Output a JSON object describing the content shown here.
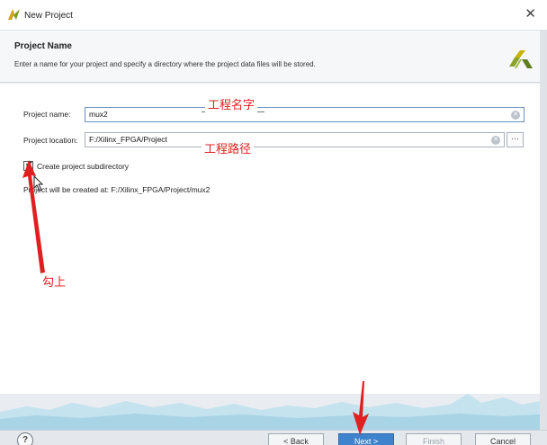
{
  "window": {
    "title": "New Project",
    "close_glyph": "✕"
  },
  "header": {
    "title": "Project Name",
    "description": "Enter a name for your project and specify a directory where the project data files will be stored."
  },
  "form": {
    "name_label": "Project name:",
    "name_value": "mux2",
    "location_label": "Project location:",
    "location_value": "F:/Xilinx_FPGA/Project",
    "browse_label": "···",
    "checkbox_label": "Create project subdirectory",
    "checkbox_checked": true,
    "checkbox_glyph": "✔",
    "created_at_text": "Project will be created at: F:/Xilinx_FPGA/Project/mux2"
  },
  "annotations": {
    "project_name": "工程名字",
    "project_path": "工程路径",
    "check_it": "勾上"
  },
  "footer": {
    "help": "?",
    "back": "< Back",
    "next": "Next >",
    "finish": "Finish",
    "cancel": "Cancel"
  },
  "colors": {
    "annotation": "#e02020",
    "primary_button": "#3f83cc"
  },
  "icons": {
    "app": "vivado-logo-icon",
    "logo": "xilinx-logo-icon",
    "clear": "clear-circle-icon",
    "arrow": "red-arrow-annotation"
  }
}
